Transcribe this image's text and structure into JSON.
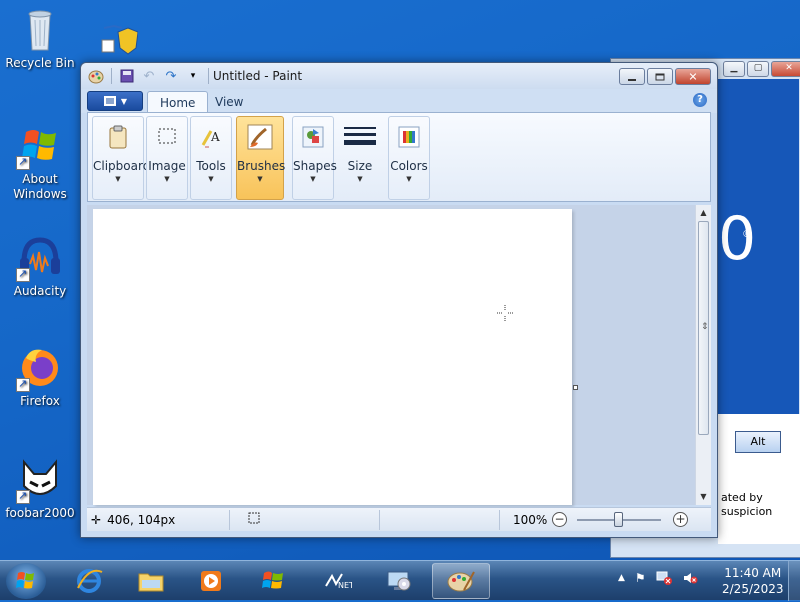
{
  "desktop": {
    "icons": [
      {
        "label": "Recycle Bin"
      },
      {
        "label": "About Windows"
      },
      {
        "label": "Audacity"
      },
      {
        "label": "Firefox"
      },
      {
        "label": "foobar2000"
      }
    ]
  },
  "background_window": {
    "button_label": "Alt",
    "text_line1": "ated by",
    "text_line2": "suspicion",
    "logo_fragment": "0",
    "registered_mark": "®"
  },
  "paint": {
    "title": "Untitled - Paint",
    "tabs": [
      {
        "label": "Home"
      },
      {
        "label": "View"
      }
    ],
    "ribbon_groups": [
      {
        "label": "Clipboard"
      },
      {
        "label": "Image"
      },
      {
        "label": "Tools"
      },
      {
        "label": "Brushes"
      },
      {
        "label": "Shapes"
      },
      {
        "label": "Size"
      },
      {
        "label": "Colors"
      }
    ],
    "status": {
      "coords": "406, 104px",
      "zoom": "100%",
      "zoom_minus": "−",
      "zoom_plus": "+"
    }
  },
  "taskbar": {
    "clock_time": "11:40 AM",
    "clock_date": "2/25/2023"
  }
}
